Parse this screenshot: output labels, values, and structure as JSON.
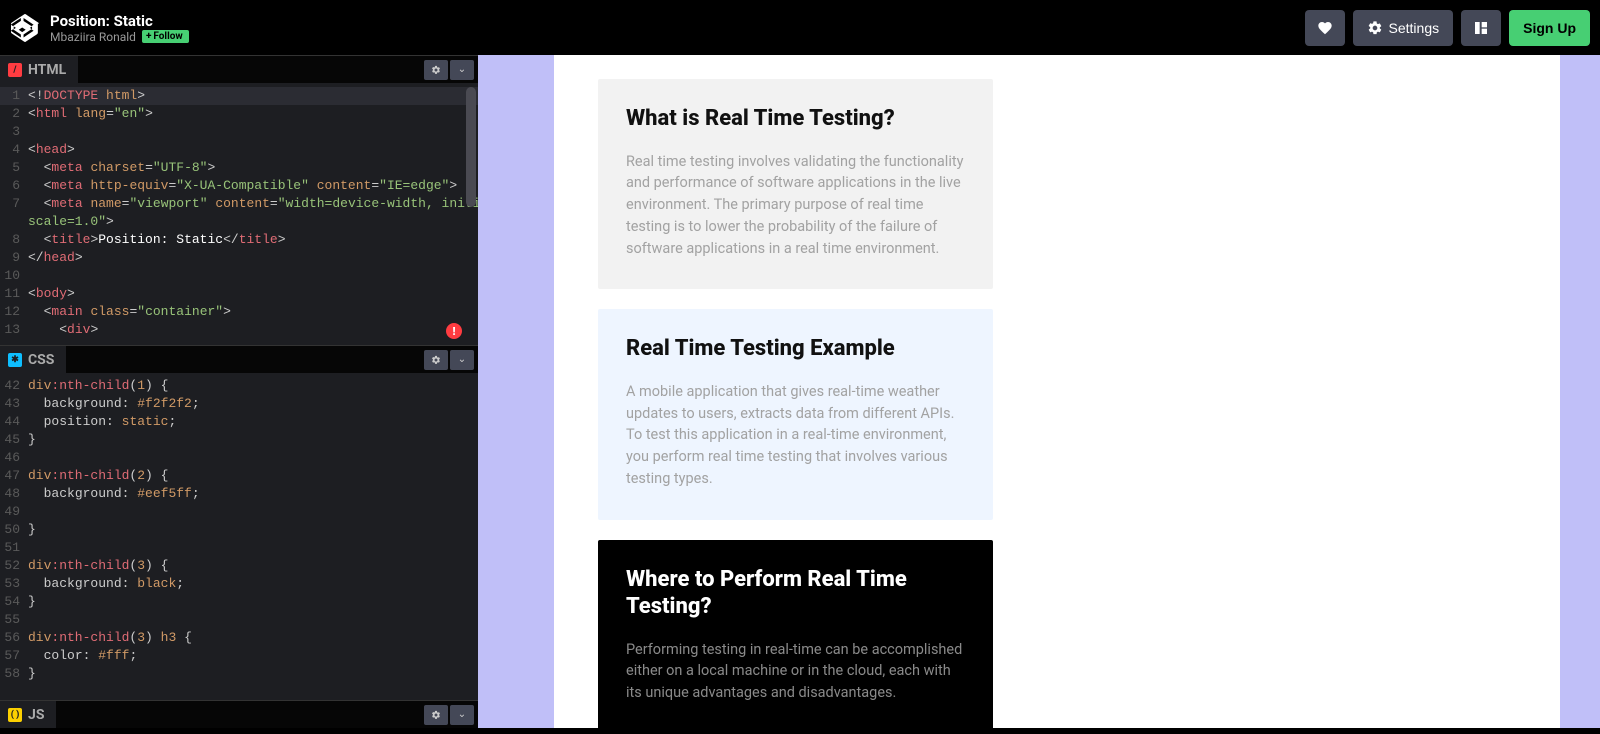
{
  "header": {
    "title": "Position: Static",
    "author": "Mbaziira Ronald",
    "follow_label": "Follow",
    "settings_label": "Settings",
    "signup_label": "Sign Up"
  },
  "panels": {
    "html_label": "HTML",
    "css_label": "CSS",
    "js_label": "JS"
  },
  "html_code": [
    {
      "n": "1",
      "html": "<span class='tok-punct'>&lt;!</span><span class='tok-tag'>DOCTYPE</span> <span class='tok-attr'>html</span><span class='tok-punct'>&gt;</span>",
      "hl": true
    },
    {
      "n": "2",
      "html": "<span class='tok-punct'>&lt;</span><span class='tok-tag'>html</span> <span class='tok-attr'>lang</span>=<span class='tok-str'>\"en\"</span><span class='tok-punct'>&gt;</span>"
    },
    {
      "n": "3",
      "html": ""
    },
    {
      "n": "4",
      "html": "<span class='tok-punct'>&lt;</span><span class='tok-tag'>head</span><span class='tok-punct'>&gt;</span>"
    },
    {
      "n": "5",
      "html": "  <span class='tok-punct'>&lt;</span><span class='tok-tag'>meta</span> <span class='tok-attr'>charset</span>=<span class='tok-str'>\"UTF-8\"</span><span class='tok-punct'>&gt;</span>"
    },
    {
      "n": "6",
      "html": "  <span class='tok-punct'>&lt;</span><span class='tok-tag'>meta</span> <span class='tok-attr'>http-equiv</span>=<span class='tok-str'>\"X-UA-Compatible\"</span> <span class='tok-attr'>content</span>=<span class='tok-str'>\"IE=edge\"</span><span class='tok-punct'>&gt;</span>"
    },
    {
      "n": "7",
      "html": "  <span class='tok-punct'>&lt;</span><span class='tok-tag'>meta</span> <span class='tok-attr'>name</span>=<span class='tok-str'>\"viewport\"</span> <span class='tok-attr'>content</span>=<span class='tok-str'>\"width=device-width, initial-</span>"
    },
    {
      "n": "",
      "html": "<span class='tok-str'>scale=1.0\"</span><span class='tok-punct'>&gt;</span>"
    },
    {
      "n": "8",
      "html": "  <span class='tok-punct'>&lt;</span><span class='tok-tag'>title</span><span class='tok-punct'>&gt;</span><span class='tok-key'>Position: Static</span><span class='tok-punct'>&lt;/</span><span class='tok-tag'>title</span><span class='tok-punct'>&gt;</span>"
    },
    {
      "n": "9",
      "html": "<span class='tok-punct'>&lt;/</span><span class='tok-tag'>head</span><span class='tok-punct'>&gt;</span>"
    },
    {
      "n": "10",
      "html": ""
    },
    {
      "n": "11",
      "html": "<span class='tok-punct'>&lt;</span><span class='tok-tag'>body</span><span class='tok-punct'>&gt;</span>"
    },
    {
      "n": "12",
      "html": "  <span class='tok-punct'>&lt;</span><span class='tok-tag'>main</span> <span class='tok-attr'>class</span>=<span class='tok-str'>\"container\"</span><span class='tok-punct'>&gt;</span>"
    },
    {
      "n": "13",
      "html": "    <span class='tok-punct'>&lt;</span><span class='tok-tag'>div</span><span class='tok-punct'>&gt;</span>"
    }
  ],
  "css_code": [
    {
      "n": "42",
      "html": "<span class='tok-sel'>div</span><span class='tok-pseudo'>:nth-child</span>(<span class='tok-num'>1</span>) {"
    },
    {
      "n": "43",
      "html": "  <span class='tok-prop'>background</span>: <span class='tok-num'>#f2f2f2</span>;"
    },
    {
      "n": "44",
      "html": "  <span class='tok-prop'>position</span>: <span class='tok-sel'>static</span>;"
    },
    {
      "n": "45",
      "html": "}"
    },
    {
      "n": "46",
      "html": ""
    },
    {
      "n": "47",
      "html": "<span class='tok-sel'>div</span><span class='tok-pseudo'>:nth-child</span>(<span class='tok-num'>2</span>) {"
    },
    {
      "n": "48",
      "html": "  <span class='tok-prop'>background</span>: <span class='tok-num'>#eef5ff</span>;"
    },
    {
      "n": "49",
      "html": ""
    },
    {
      "n": "50",
      "html": "}"
    },
    {
      "n": "51",
      "html": ""
    },
    {
      "n": "52",
      "html": "<span class='tok-sel'>div</span><span class='tok-pseudo'>:nth-child</span>(<span class='tok-num'>3</span>) {"
    },
    {
      "n": "53",
      "html": "  <span class='tok-prop'>background</span>: <span class='tok-sel'>black</span>;"
    },
    {
      "n": "54",
      "html": "}"
    },
    {
      "n": "55",
      "html": ""
    },
    {
      "n": "56",
      "html": "<span class='tok-sel'>div</span><span class='tok-pseudo'>:nth-child</span>(<span class='tok-num'>3</span>) <span class='tok-sel'>h3</span> {"
    },
    {
      "n": "57",
      "html": "  <span class='tok-prop'>color</span>: <span class='tok-num'>#fff</span>;"
    },
    {
      "n": "58",
      "html": "}"
    }
  ],
  "preview": {
    "cards": [
      {
        "title": "What is Real Time Testing?",
        "body": "Real time testing involves validating the functionality and performance of software applications in the live environment. The primary purpose of real time testing is to lower the probability of the failure of software applications in a real time environment."
      },
      {
        "title": "Real Time Testing Example",
        "body": "A mobile application that gives real-time weather updates to users, extracts data from different APIs. To test this application in a real-time environment, you perform real time testing that involves various testing types."
      },
      {
        "title": "Where to Perform Real Time Testing?",
        "body": "Performing testing in real-time can be accomplished either on a local machine or in the cloud, each with its unique advantages and disadvantages."
      }
    ]
  },
  "error_badge": "!"
}
